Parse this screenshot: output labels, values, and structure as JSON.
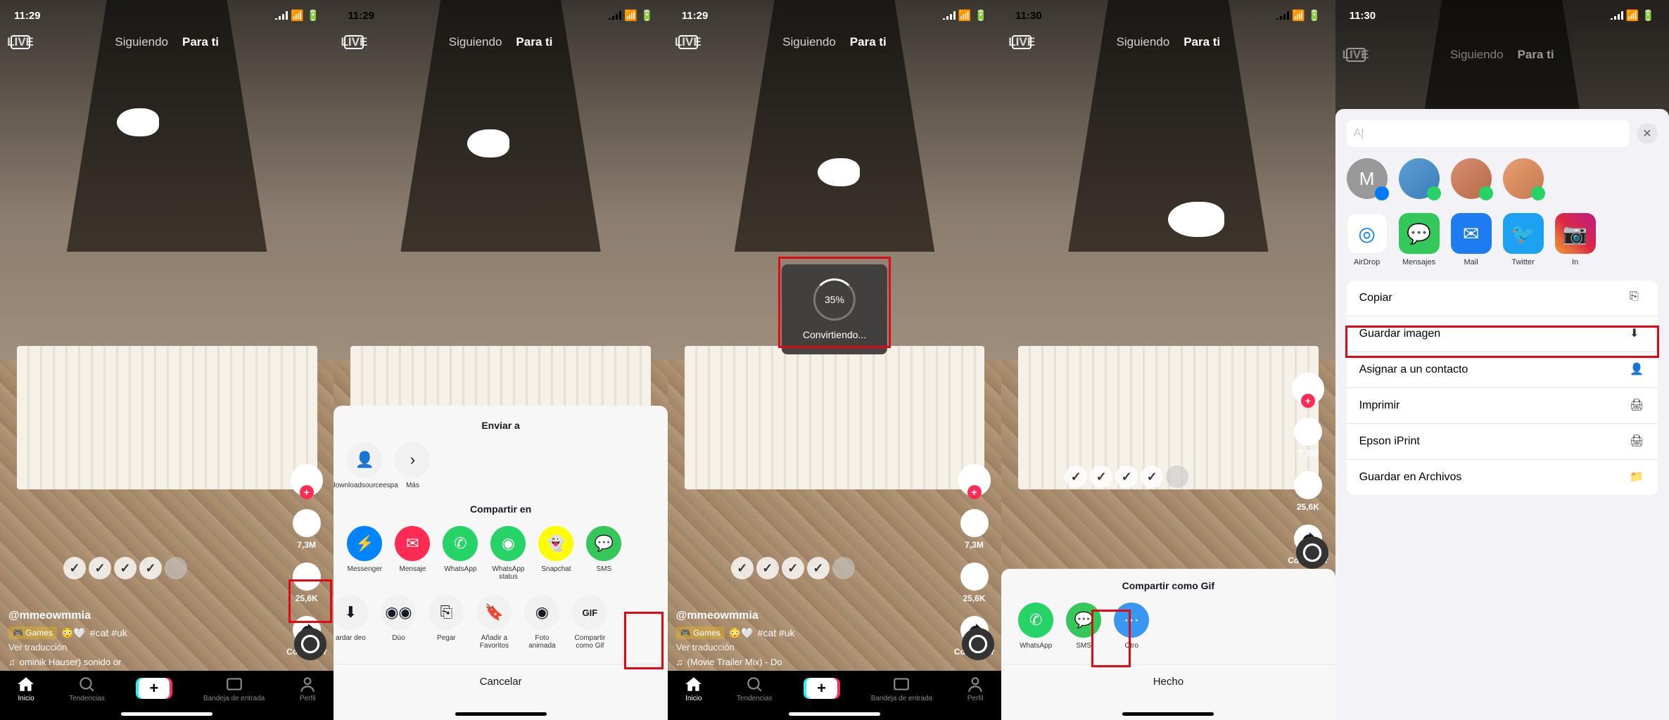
{
  "status": {
    "time1": "11:29",
    "time2": "11:29",
    "time3": "11:29",
    "time4": "11:30",
    "time5": "11:30"
  },
  "top_nav": {
    "following": "Siguiendo",
    "for_you": "Para ti",
    "live": "LIVE"
  },
  "video": {
    "username": "@mmeowmmia",
    "games_tag": "Games",
    "hashtags": "#cat #uk",
    "translate": "Ver traducción",
    "music1": "ominik Hauser)    sonido or",
    "music3": "(Movie Trailer Mix)    - Do"
  },
  "actions": {
    "likes": "7,3M",
    "comments": "25,6K",
    "share": "Compartir"
  },
  "bottom_nav": {
    "home": "Inicio",
    "trends": "Tendencias",
    "inbox": "Bandeja de entrada",
    "profile": "Perfil"
  },
  "share_sheet": {
    "send_to": "Enviar a",
    "contact1": "downloadsourceespa",
    "more": "Más",
    "share_via": "Compartir en",
    "messenger": "Messenger",
    "mensaje": "Mensaje",
    "whatsapp": "WhatsApp",
    "whatsapp_status": "WhatsApp status",
    "snapchat": "Snapchat",
    "sms": "SMS",
    "guardar_video": "ardar deo",
    "duo": "Dúo",
    "pegar": "Pegar",
    "favoritos": "Añadir a Favoritos",
    "foto_animada": "Foto animada",
    "gif": "GIF",
    "compartir_gif": "Compartir como Gif",
    "cancelar": "Cancelar"
  },
  "progress": {
    "percent": "35%",
    "text": "Convirtiendo..."
  },
  "gif_sheet": {
    "title": "Compartir como Gif",
    "whatsapp": "WhatsApp",
    "sms": "SMS",
    "otro": "Otro",
    "done": "Hecho"
  },
  "ios_sheet": {
    "contact_m": "M",
    "airdrop": "AirDrop",
    "mensajes": "Mensajes",
    "mail": "Mail",
    "twitter": "Twitter",
    "instagram": "In",
    "copiar": "Copiar",
    "guardar_imagen": "Guardar imagen",
    "asignar": "Asignar a un contacto",
    "imprimir": "Imprimir",
    "epson": "Epson iPrint",
    "archivos": "Guardar en Archivos"
  }
}
